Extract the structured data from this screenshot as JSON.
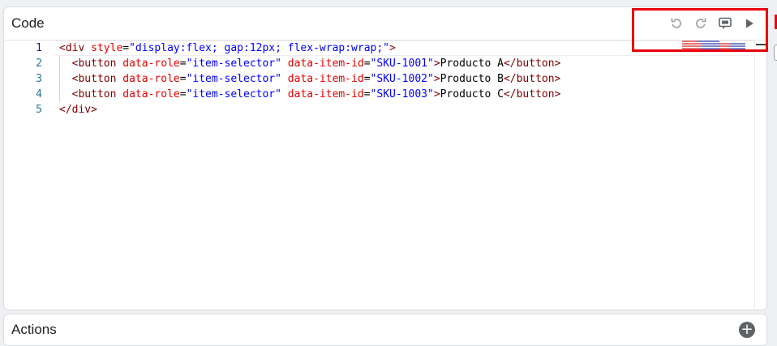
{
  "code_panel": {
    "title": "Code",
    "toolbar": {
      "undo_icon": "undo-icon",
      "redo_icon": "redo-icon",
      "preview_icon": "preview-icon",
      "run_icon": "play-icon"
    }
  },
  "editor": {
    "lines": [
      {
        "number": "1",
        "tokens": [
          {
            "t": "tag",
            "v": "<div"
          },
          {
            "t": "text",
            "v": " "
          },
          {
            "t": "attr",
            "v": "style"
          },
          {
            "t": "text",
            "v": "="
          },
          {
            "t": "val",
            "v": "\"display:flex; gap:12px; flex-wrap:wrap;\""
          },
          {
            "t": "tag",
            "v": ">"
          }
        ]
      },
      {
        "number": "2",
        "tokens": [
          {
            "t": "text",
            "v": "  "
          },
          {
            "t": "tag",
            "v": "<button"
          },
          {
            "t": "text",
            "v": " "
          },
          {
            "t": "attr",
            "v": "data-role"
          },
          {
            "t": "text",
            "v": "="
          },
          {
            "t": "val",
            "v": "\"item-selector\""
          },
          {
            "t": "text",
            "v": " "
          },
          {
            "t": "attr",
            "v": "data-item-id"
          },
          {
            "t": "text",
            "v": "="
          },
          {
            "t": "val",
            "v": "\"SKU-1001\""
          },
          {
            "t": "tag",
            "v": ">"
          },
          {
            "t": "text",
            "v": "Producto A"
          },
          {
            "t": "tag",
            "v": "</button>"
          }
        ]
      },
      {
        "number": "3",
        "tokens": [
          {
            "t": "text",
            "v": "  "
          },
          {
            "t": "tag",
            "v": "<button"
          },
          {
            "t": "text",
            "v": " "
          },
          {
            "t": "attr",
            "v": "data-role"
          },
          {
            "t": "text",
            "v": "="
          },
          {
            "t": "val",
            "v": "\"item-selector\""
          },
          {
            "t": "text",
            "v": " "
          },
          {
            "t": "attr",
            "v": "data-item-id"
          },
          {
            "t": "text",
            "v": "="
          },
          {
            "t": "val",
            "v": "\"SKU-1002\""
          },
          {
            "t": "tag",
            "v": ">"
          },
          {
            "t": "text",
            "v": "Producto B"
          },
          {
            "t": "tag",
            "v": "</button>"
          }
        ]
      },
      {
        "number": "4",
        "tokens": [
          {
            "t": "text",
            "v": "  "
          },
          {
            "t": "tag",
            "v": "<button"
          },
          {
            "t": "text",
            "v": " "
          },
          {
            "t": "attr",
            "v": "data-role"
          },
          {
            "t": "text",
            "v": "="
          },
          {
            "t": "val",
            "v": "\"item-selector\""
          },
          {
            "t": "text",
            "v": " "
          },
          {
            "t": "attr",
            "v": "data-item-id"
          },
          {
            "t": "text",
            "v": "="
          },
          {
            "t": "val",
            "v": "\"SKU-1003\""
          },
          {
            "t": "tag",
            "v": ">"
          },
          {
            "t": "text",
            "v": "Producto C"
          },
          {
            "t": "tag",
            "v": "</button>"
          }
        ]
      },
      {
        "number": "5",
        "tokens": [
          {
            "t": "tag",
            "v": "</div>"
          }
        ]
      }
    ]
  },
  "actions_panel": {
    "title": "Actions",
    "add_label": "+"
  },
  "colors": {
    "tag": "#800000",
    "attribute": "#e50000",
    "value": "#0000ff",
    "line_number": "#237893",
    "highlight": "#e8000b"
  }
}
